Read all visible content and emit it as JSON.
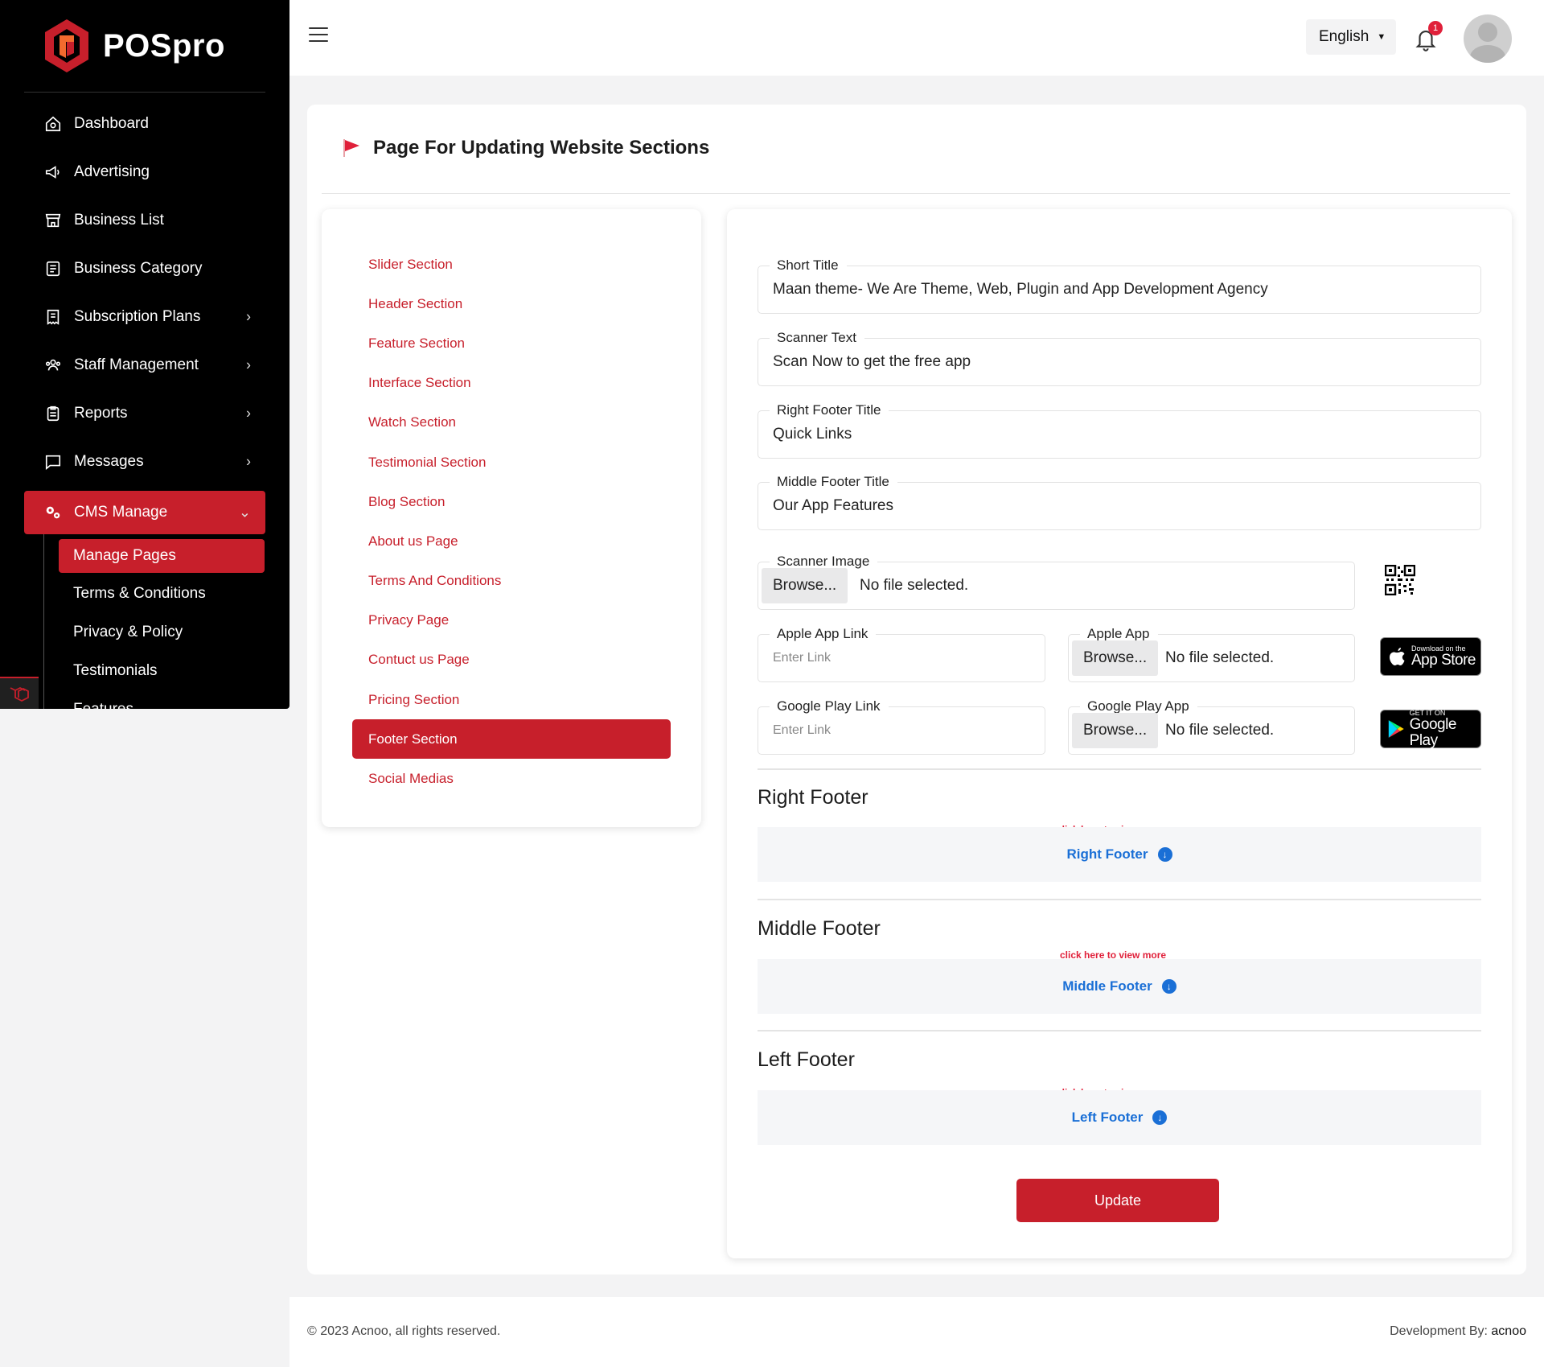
{
  "brand": {
    "name": "POSpro",
    "accent": "#c71f2b"
  },
  "sidebar": {
    "items": [
      {
        "label": "Dashboard",
        "icon": "home-icon",
        "chevron": false
      },
      {
        "label": "Advertising",
        "icon": "megaphone-icon",
        "chevron": false
      },
      {
        "label": "Business List",
        "icon": "store-icon",
        "chevron": false
      },
      {
        "label": "Business Category",
        "icon": "list-icon",
        "chevron": false
      },
      {
        "label": "Subscription Plans",
        "icon": "receipt-icon",
        "chevron": true
      },
      {
        "label": "Staff Management",
        "icon": "users-icon",
        "chevron": true
      },
      {
        "label": "Reports",
        "icon": "clipboard-icon",
        "chevron": true
      },
      {
        "label": "Messages",
        "icon": "message-icon",
        "chevron": true
      },
      {
        "label": "CMS Manage",
        "icon": "gears-icon",
        "chevron": true,
        "active": true
      }
    ],
    "sub_items": [
      {
        "label": "Manage Pages",
        "active": true
      },
      {
        "label": "Terms & Conditions"
      },
      {
        "label": "Privacy & Policy"
      },
      {
        "label": "Testimonials"
      },
      {
        "label": "Features"
      }
    ]
  },
  "topbar": {
    "language": "English",
    "notification_count": "1"
  },
  "page": {
    "title": "Page For Updating Website Sections"
  },
  "section_menu": {
    "items": [
      "Slider Section",
      "Header Section",
      "Feature Section",
      "Interface Section",
      "Watch Section",
      "Testimonial Section",
      "Blog Section",
      "About us Page",
      "Terms And Conditions",
      "Privacy Page",
      "Contuct us Page",
      "Pricing Section",
      "Footer Section",
      "Social Medias"
    ],
    "active_index": 12
  },
  "form": {
    "short_title": {
      "label": "Short Title",
      "value": "Maan theme- We Are Theme, Web, Plugin and App Development Agency"
    },
    "scanner_text": {
      "label": "Scanner Text",
      "value": "Scan Now to get the free app"
    },
    "right_footer_title": {
      "label": "Right Footer Title",
      "value": "Quick Links"
    },
    "middle_footer_title": {
      "label": "Middle Footer Title",
      "value": "Our App Features"
    },
    "scanner_image": {
      "label": "Scanner Image",
      "browse": "Browse...",
      "status": "No file selected."
    },
    "apple_app_link": {
      "label": "Apple App Link",
      "placeholder": "Enter Link"
    },
    "apple_app": {
      "label": "Apple App",
      "browse": "Browse...",
      "status": "No file selected."
    },
    "google_play_link": {
      "label": "Google Play Link",
      "placeholder": "Enter Link"
    },
    "google_play_app": {
      "label": "Google Play App",
      "browse": "Browse...",
      "status": "No file selected."
    },
    "app_store_badge": {
      "line1": "Download on the",
      "line2": "App Store"
    },
    "google_play_badge": {
      "line1": "GET IT ON",
      "line2": "Google Play"
    },
    "sections": [
      {
        "title": "Right Footer",
        "hint": "click here to view more",
        "toggle": "Right Footer"
      },
      {
        "title": "Middle Footer",
        "hint": "click here to view more",
        "toggle": "Middle Footer"
      },
      {
        "title": "Left Footer",
        "hint": "click here to view more",
        "toggle": "Left Footer"
      }
    ],
    "update_label": "Update"
  },
  "footer": {
    "copyright": "© 2023 Acnoo, all rights reserved.",
    "dev_prefix": "Development By:",
    "dev_name": "acnoo"
  }
}
